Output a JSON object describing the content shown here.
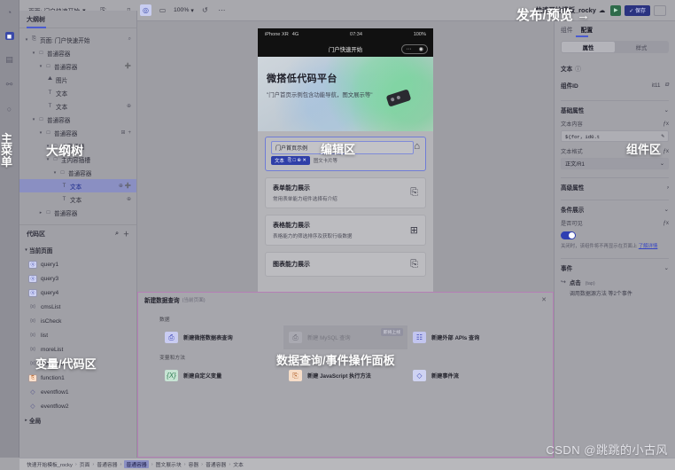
{
  "rail": {
    "items": [
      {
        "name": "logo-icon",
        "glyph": "◔"
      },
      {
        "name": "components-icon",
        "glyph": "■"
      },
      {
        "name": "pages-icon",
        "glyph": "▤"
      },
      {
        "name": "data-source-icon",
        "glyph": "⚯"
      },
      {
        "name": "history-icon",
        "glyph": "○"
      }
    ],
    "overlay_label": "主菜单"
  },
  "topbar": {
    "page_select": "页面: 门户快速开始",
    "copy_icon": "⎘",
    "devices": [
      {
        "name": "device-phone",
        "glyph": "▯"
      },
      {
        "name": "device-tablet",
        "glyph": "◎"
      },
      {
        "name": "device-desktop",
        "glyph": "▭"
      }
    ],
    "zoom": "100%",
    "undo_icon": "↺",
    "more_icon": "⋯",
    "title": "快速开始模板_rocky",
    "title_icon": "☁",
    "save_label": "✓ 保存",
    "publish_annotation": "发布/预览  →"
  },
  "outline": {
    "title": "大纲树",
    "search_icon": "⌕",
    "overlay_label": "大纲树",
    "nodes": [
      {
        "depth": 0,
        "caret": "▾",
        "icon": "⎘",
        "label": "页面: 门户快速开始",
        "action": "⌕",
        "selected": false
      },
      {
        "depth": 1,
        "caret": "▾",
        "icon": "□",
        "label": "普通容器",
        "action": "",
        "selected": false
      },
      {
        "depth": 2,
        "caret": "▾",
        "icon": "□",
        "label": "普通容器",
        "action": "➕",
        "selected": false
      },
      {
        "depth": 3,
        "caret": "",
        "icon": "⛰",
        "label": "图片",
        "action": "",
        "selected": false
      },
      {
        "depth": 3,
        "caret": "",
        "icon": "T",
        "label": "文本",
        "action": "",
        "selected": false
      },
      {
        "depth": 3,
        "caret": "",
        "icon": "T",
        "label": "文本",
        "action": "⊕",
        "selected": false
      },
      {
        "depth": 1,
        "caret": "▾",
        "icon": "□",
        "label": "普通容器",
        "action": "",
        "selected": false
      },
      {
        "depth": 2,
        "caret": "▾",
        "icon": "□",
        "label": "普通容器",
        "action": "⊞",
        "selected": false
      },
      {
        "depth": 3,
        "caret": "▾",
        "icon": "□",
        "label": "内容插槽",
        "action": "",
        "selected": false
      },
      {
        "depth": 3,
        "caret": "▾",
        "icon": "□",
        "label": "主内容插槽",
        "action": "",
        "selected": false
      },
      {
        "depth": 4,
        "caret": "▾",
        "icon": "□",
        "label": "普通容器",
        "action": "",
        "selected": false
      },
      {
        "depth": 5,
        "caret": "",
        "icon": "T",
        "label": "文本",
        "action": "⊕ ➕",
        "selected": true
      },
      {
        "depth": 5,
        "caret": "",
        "icon": "T",
        "label": "文本",
        "action": "⊕",
        "selected": false
      },
      {
        "depth": 2,
        "caret": "▸",
        "icon": "□",
        "label": "普通容器",
        "action": "",
        "selected": false
      }
    ]
  },
  "codepane": {
    "title": "代码区",
    "search_icon": "⌕",
    "add_icon": "＋",
    "overlay_label": "变量/代码区",
    "groups": [
      {
        "caret": "▾",
        "label": "当前页面"
      },
      {
        "caret": "▸",
        "label": "全局"
      }
    ],
    "items": [
      {
        "kind": "q",
        "icon": "ⓠ",
        "label": "query1"
      },
      {
        "kind": "q",
        "icon": "ⓠ",
        "label": "query3"
      },
      {
        "kind": "q",
        "icon": "ⓠ",
        "label": "query4"
      },
      {
        "kind": "x",
        "icon": "{x}",
        "label": "cmsList"
      },
      {
        "kind": "x",
        "icon": "{x}",
        "label": "isCheck"
      },
      {
        "kind": "x",
        "icon": "{x}",
        "label": "list"
      },
      {
        "kind": "x",
        "icon": "{x}",
        "label": "moreList"
      },
      {
        "kind": "x",
        "icon": "{x}",
        "label": "sheetList"
      },
      {
        "kind": "f",
        "icon": "⎘",
        "label": "function1"
      },
      {
        "kind": "e",
        "icon": "◇",
        "label": "eventflow1"
      },
      {
        "kind": "e",
        "icon": "◇",
        "label": "eventflow2"
      }
    ]
  },
  "canvas": {
    "overlay_label": "编辑区",
    "status": {
      "device": "iPhone XR",
      "network": "4G",
      "time": "07:34",
      "battery": "100%"
    },
    "nav_title": "门户快速开始",
    "capsule_more": "⋯",
    "capsule_close": "◉",
    "hero_title": "微搭低代码平台",
    "hero_sub": "\"门户首页示例包含功能导航，图文展示等\"",
    "selected_field_value": "门户首页示例",
    "selected_tag": "文本",
    "selected_tag_actions": "⎘ □ ⊕ ✕",
    "selected_hint": "图文卡片等",
    "home_icon": "⌂",
    "cards": [
      {
        "title": "表单能力展示",
        "sub": "常用表单能力组件选择有介绍",
        "icon": "⎘"
      },
      {
        "title": "表格能力展示",
        "sub": "表格能力的筛选排序及获取行级数据",
        "icon": "⊞"
      },
      {
        "title": "图表能力展示",
        "sub": "",
        "icon": "⎘"
      }
    ]
  },
  "properties": {
    "tabs": [
      {
        "label": "组件",
        "active": false
      },
      {
        "label": "配置",
        "active": true
      }
    ],
    "segments": [
      {
        "label": "属性",
        "active": true
      },
      {
        "label": "样式",
        "active": false
      }
    ],
    "component_type": "文本",
    "component_type_info": "ⓘ",
    "component_id_label": "组件ID",
    "component_id_value": "it11",
    "component_id_icon": "⧉",
    "basic_section": "基础属性",
    "basic_caret": "⌄",
    "text_content_label": "文本内容",
    "text_content_fx": "ƒx",
    "text_content_value": "${for，id0.t",
    "text_content_edit_icon": "✎",
    "text_format_label": "文本格式",
    "text_format_fx": "ƒx",
    "text_format_value": "正文/R1",
    "text_format_caret": "⌄",
    "advanced_section": "高级属性",
    "advanced_caret": "›",
    "condition_section": "条件展示",
    "condition_caret": "⌄",
    "visible_label": "是否可见",
    "visible_fx": "ƒx",
    "visible_on": true,
    "visible_hint": "关闭时，该组件将不再显示在页面上",
    "visible_hint_link": "了解详情",
    "events_section": "事件",
    "events_caret": "⌄",
    "event_name": "点击",
    "event_code": "(tap)",
    "event_desc": "调用数据源方法 等2个事件",
    "overlay_label": "组件区"
  },
  "datapanel": {
    "title": "新建数据查询",
    "subtitle": "(当前页面)",
    "close_icon": "✕",
    "overlay_label": "数据查询/事件操作面板",
    "sections": [
      {
        "label": "数据",
        "items": [
          {
            "label": "新建微搭数据表查询",
            "icon": "⎙",
            "style": "b1",
            "disabled": false,
            "badge": ""
          },
          {
            "label": "新建 MySQL 查询",
            "icon": "⎙",
            "style": "b2",
            "disabled": true,
            "badge": "即将上线"
          },
          {
            "label": "新建外部 APIs 查询",
            "icon": "☷",
            "style": "b3",
            "disabled": false,
            "badge": ""
          }
        ]
      },
      {
        "label": "变量和方法",
        "items": [
          {
            "label": "新建自定义变量",
            "icon": "{X}",
            "style": "g1",
            "disabled": false,
            "badge": ""
          },
          {
            "label": "新建 JavaScript 执行方法",
            "icon": "⎘",
            "style": "o1",
            "disabled": false,
            "badge": ""
          },
          {
            "label": "新建事件流",
            "icon": "◇",
            "style": "p1",
            "disabled": false,
            "badge": ""
          }
        ]
      }
    ]
  },
  "breadcrumb": {
    "items": [
      "快速开始模板_rocky",
      "页面",
      "普通容器",
      "普通容器",
      "图文展示块",
      "容器",
      "普通容器",
      "文本"
    ],
    "current_index": 3,
    "separator": "›"
  },
  "watermark": "CSDN @跳跳的小古风"
}
